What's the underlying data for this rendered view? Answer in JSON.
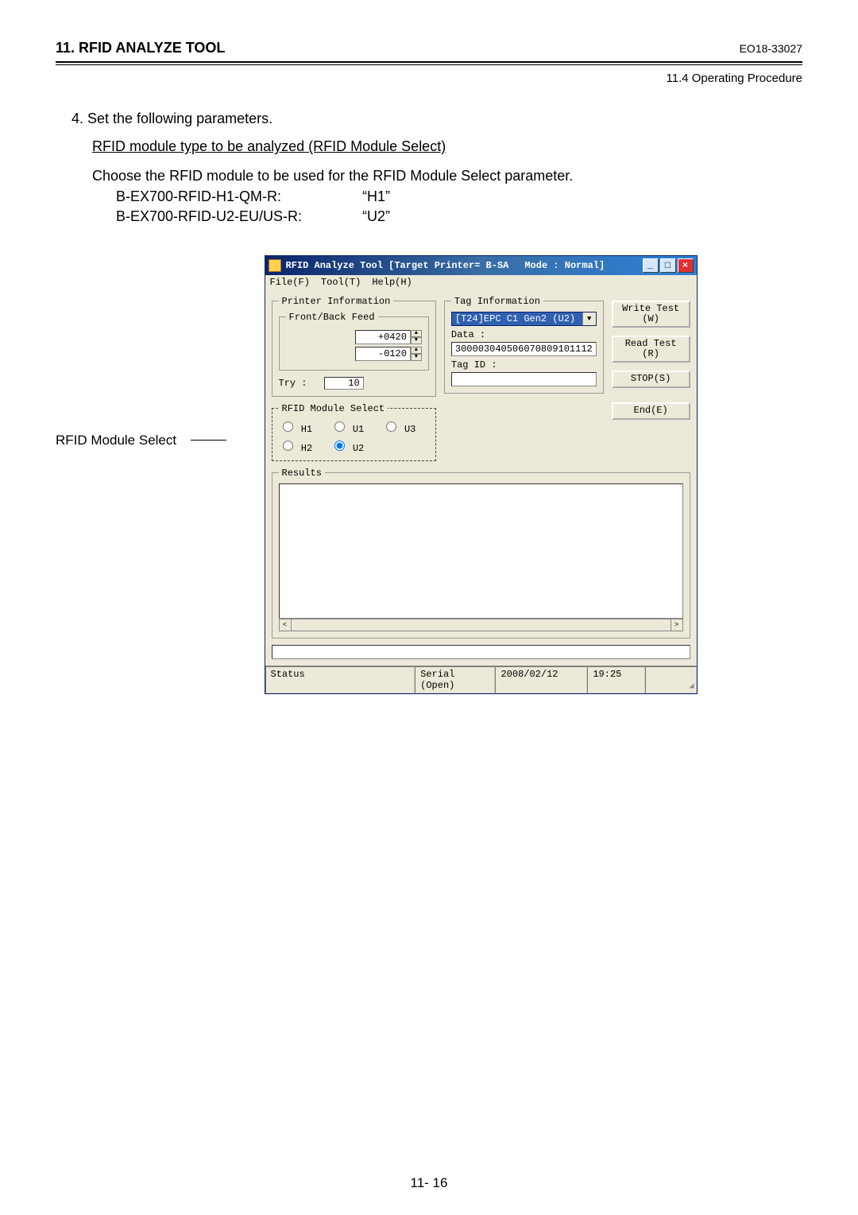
{
  "header": {
    "title": "11. RFID ANALYZE TOOL",
    "code": "EO18-33027",
    "subheader": "11.4 Operating Procedure"
  },
  "body": {
    "step": "4.  Set the following parameters.",
    "underline": "RFID module type to be analyzed (RFID Module Select)",
    "choose": "Choose the RFID module to be used for the RFID Module Select parameter.",
    "modules": [
      {
        "name": "B-EX700-RFID-H1-QM-R:",
        "val": "“H1”"
      },
      {
        "name": "B-EX700-RFID-U2-EU/US-R:",
        "val": "“U2”"
      }
    ],
    "callout": "RFID Module Select"
  },
  "window": {
    "title_left": "RFID Analyze Tool [Target Printer= B-SA",
    "title_mode": "Mode : Normal]",
    "menu": {
      "file": "File(F)",
      "tool": "Tool(T)",
      "help": "Help(H)"
    },
    "printer_info": {
      "legend": "Printer Information",
      "feed_legend": "Front/Back Feed",
      "front": "+0420",
      "back": "-0120",
      "try_label": "Try :",
      "try": "10"
    },
    "rfid_select": {
      "legend": "RFID Module Select",
      "options": [
        "H1",
        "U1",
        "U3",
        "H2",
        "U2"
      ],
      "selected": "U2"
    },
    "tag_info": {
      "legend": "Tag Information",
      "combo": "[T24]EPC C1 Gen2 (U2)",
      "data_label": "Data :",
      "data": "300003040506070809101112",
      "tagid_label": "Tag ID :",
      "tagid": ""
    },
    "buttons": {
      "write": "Write Test\n(W)",
      "read": "Read Test\n(R)",
      "stop": "STOP(S)",
      "end": "End(E)"
    },
    "results_legend": "Results",
    "status": {
      "s1": "Status",
      "s2": "Serial (Open)",
      "s3": "2008/02/12",
      "s4": "19:25"
    }
  },
  "footer": "11- 16"
}
